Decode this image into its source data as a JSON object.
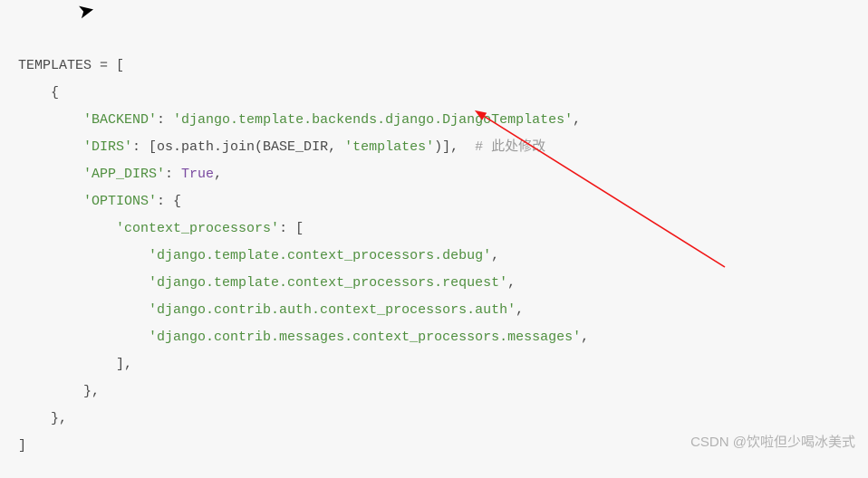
{
  "code": {
    "l1": "TEMPLATES = [",
    "l2": "    {",
    "l3a": "        ",
    "l3b": "'BACKEND'",
    "l3c": ": ",
    "l3d": "'django.template.backends.django.DjangoTemplates'",
    "l3e": ",",
    "l4a": "        ",
    "l4b": "'DIRS'",
    "l4c": ": [os.path.join(BASE_DIR, ",
    "l4d": "'templates'",
    "l4e": ")],  ",
    "l4f": "# 此处修改",
    "l5a": "        ",
    "l5b": "'APP_DIRS'",
    "l5c": ": ",
    "l5d": "True",
    "l5e": ",",
    "l6a": "        ",
    "l6b": "'OPTIONS'",
    "l6c": ": {",
    "l7a": "            ",
    "l7b": "'context_processors'",
    "l7c": ": [",
    "l8a": "                ",
    "l8b": "'django.template.context_processors.debug'",
    "l8c": ",",
    "l9a": "                ",
    "l9b": "'django.template.context_processors.request'",
    "l9c": ",",
    "l10a": "                ",
    "l10b": "'django.contrib.auth.context_processors.auth'",
    "l10c": ",",
    "l11a": "                ",
    "l11b": "'django.contrib.messages.context_processors.messages'",
    "l11c": ",",
    "l12": "            ],",
    "l13": "        },",
    "l14": "    },",
    "l15": "]"
  },
  "watermark": "CSDN @饮啦但少喝冰美式"
}
